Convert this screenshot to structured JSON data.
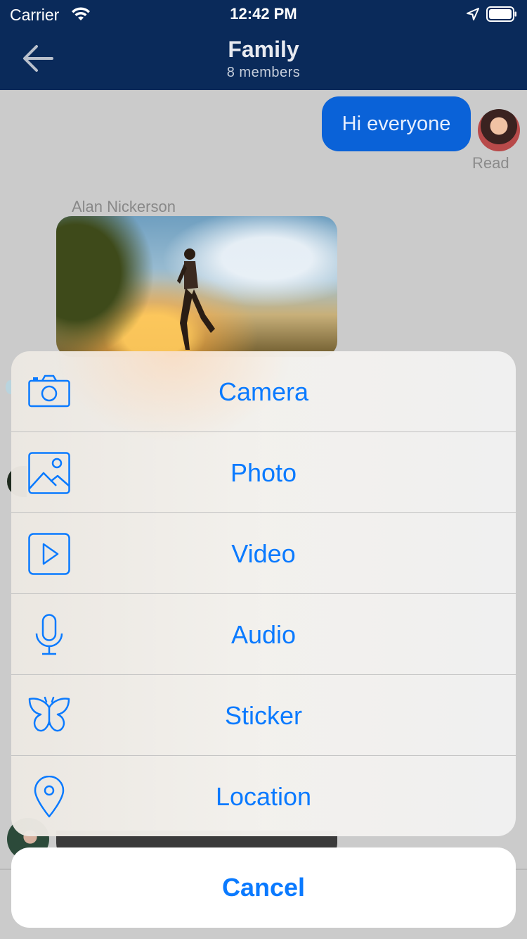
{
  "status_bar": {
    "carrier": "Carrier",
    "time": "12:42 PM",
    "icons": [
      "wifi-icon",
      "location-arrow-icon",
      "battery-icon"
    ]
  },
  "nav": {
    "title": "Family",
    "subtitle": "8 members",
    "back_icon": "back-arrow-icon"
  },
  "chat": {
    "outgoing_message": "Hi everyone",
    "read_receipt": "Read",
    "incoming_sender": "Alan Nickerson"
  },
  "action_sheet": {
    "items": [
      {
        "label": "Camera",
        "icon": "camera-icon"
      },
      {
        "label": "Photo",
        "icon": "photo-icon"
      },
      {
        "label": "Video",
        "icon": "video-icon"
      },
      {
        "label": "Audio",
        "icon": "microphone-icon"
      },
      {
        "label": "Sticker",
        "icon": "butterfly-icon"
      },
      {
        "label": "Location",
        "icon": "location-pin-icon"
      }
    ],
    "cancel_label": "Cancel"
  },
  "colors": {
    "nav_background": "#0a2a5a",
    "accent": "#0a7aff",
    "outgoing_bubble": "#0a62d8"
  }
}
